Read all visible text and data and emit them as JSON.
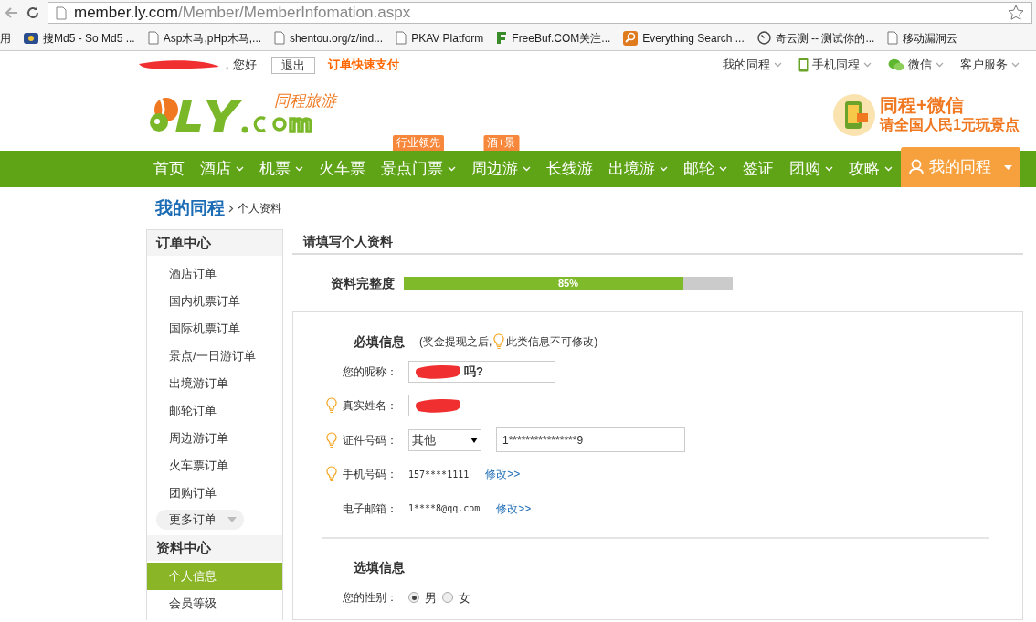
{
  "browser": {
    "url_host": "member.ly.com",
    "url_path": "/Member/MemberInfomation.aspx"
  },
  "bookmarks": [
    {
      "label": "用",
      "kind": "apps"
    },
    {
      "label": "搜Md5 - So Md5 ...",
      "kind": "site"
    },
    {
      "label": "Asp木马,pHp木马,...",
      "kind": "page"
    },
    {
      "label": "shentou.org/z/ind...",
      "kind": "page"
    },
    {
      "label": "PKAV Platform",
      "kind": "page"
    },
    {
      "label": "FreeBuf.COM关注...",
      "kind": "freebuf"
    },
    {
      "label": "Everything Search ...",
      "kind": "search"
    },
    {
      "label": "奇云测 -- 测试你的...",
      "kind": "clock"
    },
    {
      "label": "移动漏洞云",
      "kind": "page"
    }
  ],
  "topbar": {
    "greeting": "，您好",
    "logout": "退出",
    "quick_pay": "订单快速支付",
    "links": [
      {
        "label": "我的同程",
        "kind": "plain"
      },
      {
        "label": "手机同程",
        "kind": "phone"
      },
      {
        "label": "微信",
        "kind": "wechat"
      },
      {
        "label": "客户服务",
        "kind": "plain"
      }
    ]
  },
  "header": {
    "logo_text": "同程旅游",
    "promo_title": "同程+微信",
    "promo_sub": "请全国人民1元玩景点"
  },
  "nav": [
    {
      "label": "首页",
      "dropdown": false
    },
    {
      "label": "酒店",
      "dropdown": true
    },
    {
      "label": "机票",
      "dropdown": true
    },
    {
      "label": "火车票",
      "dropdown": false
    },
    {
      "label": "景点门票",
      "dropdown": true,
      "badge": "行业领先"
    },
    {
      "label": "周边游",
      "dropdown": true,
      "badge": "酒+景"
    },
    {
      "label": "长线游",
      "dropdown": false
    },
    {
      "label": "出境游",
      "dropdown": true
    },
    {
      "label": "邮轮",
      "dropdown": true
    },
    {
      "label": "签证",
      "dropdown": false
    },
    {
      "label": "团购",
      "dropdown": true
    },
    {
      "label": "攻略",
      "dropdown": true
    }
  ],
  "nav_account": {
    "label": "我的同程",
    "selected": true
  },
  "breadcrumb": {
    "root": "我的同程",
    "current": "个人资料"
  },
  "sidebar": [
    {
      "title": "订单中心",
      "items": [
        {
          "label": "酒店订单",
          "selected": false
        },
        {
          "label": "国内机票订单",
          "selected": false
        },
        {
          "label": "国际机票订单",
          "selected": false
        },
        {
          "label": "景点/一日游订单",
          "selected": false
        },
        {
          "label": "出境游订单",
          "selected": false
        },
        {
          "label": "邮轮订单",
          "selected": false
        },
        {
          "label": "周边游订单",
          "selected": false
        },
        {
          "label": "火车票订单",
          "selected": false
        },
        {
          "label": "团购订单",
          "selected": false
        }
      ],
      "more": "更多订单"
    },
    {
      "title": "资料中心",
      "items": [
        {
          "label": "个人信息",
          "selected": true
        },
        {
          "label": "会员等级",
          "selected": false
        }
      ]
    }
  ],
  "main": {
    "title": "请填写个人资料",
    "completeness": {
      "label": "资料完整度",
      "level": 0.85,
      "reading": "85%"
    },
    "required": {
      "title": "必填信息",
      "note_before": "(奖金提现之后,",
      "note_after": "此类信息不可修改)",
      "rows": [
        {
          "kind": "text",
          "label": "您的昵称：",
          "hint": false,
          "value": "吗?",
          "redacted": true
        },
        {
          "kind": "text",
          "label": "真实姓名：",
          "hint": true,
          "value": "",
          "redacted": true
        },
        {
          "kind": "id",
          "label": "证件号码：",
          "hint": true,
          "select": "其他",
          "value": "1****************9"
        },
        {
          "kind": "info",
          "label": "手机号码：",
          "hint": true,
          "value": "157****1111",
          "link": "修改>>"
        },
        {
          "kind": "info",
          "label": "电子邮箱：",
          "hint": false,
          "value": "1****8@qq.com",
          "link": "修改>>"
        }
      ]
    },
    "optional": {
      "title": "选填信息",
      "rows": [
        {
          "kind": "radio",
          "label": "您的性别：",
          "options": [
            {
              "label": "男",
              "selected": true
            },
            {
              "label": "女",
              "selected": false
            }
          ]
        }
      ]
    }
  }
}
